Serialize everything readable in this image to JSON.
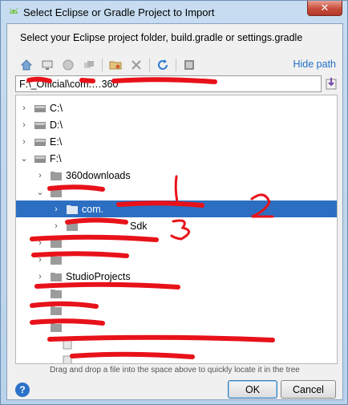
{
  "window": {
    "title": "Select Eclipse or Gradle Project to Import",
    "close_label": "✕"
  },
  "dialog": {
    "heading": "Select your Eclipse project folder, build.gradle or settings.gradle",
    "hide_path_label": "Hide path",
    "path_value": "F:\\_Official\\com.…360",
    "hint": "Drag and drop a file into the space above to quickly locate it in the tree",
    "help_label": "?",
    "ok_label": "OK",
    "cancel_label": "Cancel"
  },
  "toolbar": {
    "icons": [
      "home-icon",
      "desktop-icon",
      "new-folder-icon",
      "show-hidden-icon",
      "delete-icon",
      "refresh-icon",
      "project-icon"
    ]
  },
  "tree": {
    "rows": [
      {
        "label": "C:\\",
        "arrow": "›",
        "icon": "drive-icon"
      },
      {
        "label": "D:\\",
        "arrow": "›",
        "icon": "drive-icon"
      },
      {
        "label": "E:\\",
        "arrow": "›",
        "icon": "drive-icon"
      },
      {
        "label": "F:\\",
        "arrow": "⌄",
        "icon": "drive-icon"
      },
      {
        "label": "360downloads",
        "arrow": "›",
        "icon": "folder-icon"
      },
      {
        "label": "",
        "arrow": "⌄",
        "icon": "folder-icon"
      },
      {
        "label": "com.",
        "arrow": "›",
        "icon": "folder-icon"
      },
      {
        "label": "Sdk",
        "arrow": "›",
        "icon": "folder-icon"
      },
      {
        "label": "",
        "arrow": "›",
        "icon": "folder-icon"
      },
      {
        "label": "",
        "arrow": "›",
        "icon": "folder-icon"
      },
      {
        "label": "StudioProjects",
        "arrow": "›",
        "icon": "folder-icon"
      },
      {
        "label": "",
        "arrow": "",
        "icon": "folder-icon"
      },
      {
        "label": "",
        "arrow": "",
        "icon": "folder-icon"
      },
      {
        "label": "",
        "arrow": "",
        "icon": "folder-icon"
      },
      {
        "label": "",
        "arrow": "",
        "icon": "file-icon"
      },
      {
        "label": "",
        "arrow": "",
        "icon": "file-icon"
      }
    ]
  },
  "colors": {
    "selection": "#2c6fc2",
    "link": "#2470c7",
    "scribble": "#e8121a"
  }
}
